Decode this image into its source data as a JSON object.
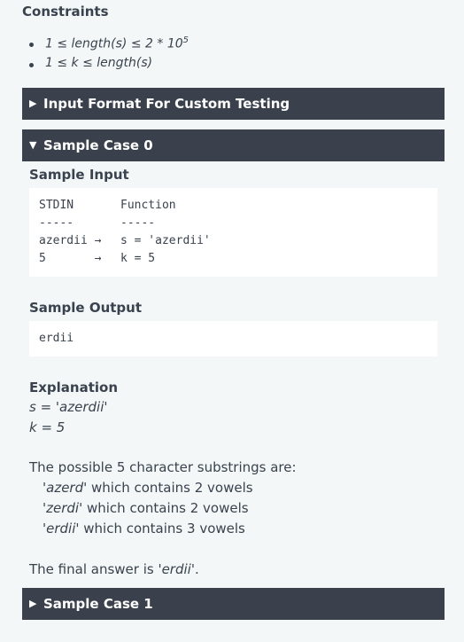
{
  "constraints": {
    "title": "Constraints",
    "items": [
      {
        "pre": "1 ≤ length(s) ≤ 2 * 10",
        "sup": "5"
      },
      {
        "pre": "1 ≤ k ≤ length(s)",
        "sup": ""
      }
    ]
  },
  "accordion_input_format": {
    "arrow": "▶",
    "label": "Input Format For Custom Testing"
  },
  "sample_case_0": {
    "arrow": "▼",
    "label": "Sample Case 0",
    "sample_input_title": "Sample Input",
    "input_rows": [
      {
        "left": "STDIN",
        "right": "Function"
      },
      {
        "left": "-----",
        "right": "-----"
      },
      {
        "left": "azerdii →",
        "right": "s = 'azerdii'"
      },
      {
        "left": "5       →",
        "right": "k = 5"
      }
    ],
    "sample_output_title": "Sample Output",
    "output_value": "erdii",
    "explanation_title": "Explanation",
    "explanation_lines": [
      "s = 'azerdii'",
      "k = 5"
    ],
    "substrings_intro": "The possible 5 character substrings are:",
    "substrings": [
      {
        "q1": "'",
        "word": "azerd",
        "q2": "'",
        "rest": " which contains 2 vowels"
      },
      {
        "q1": "'",
        "word": "zerdi",
        "q2": "'",
        "rest": " which contains 2 vowels"
      },
      {
        "q1": "'",
        "word": "erdii",
        "q2": "'",
        "rest": " which contains 3 vowels"
      }
    ],
    "final_pre": "The final answer is '",
    "final_word": "erdii",
    "final_post": "'."
  },
  "accordion_sample_case_1": {
    "arrow": "▶",
    "label": "Sample Case 1"
  }
}
